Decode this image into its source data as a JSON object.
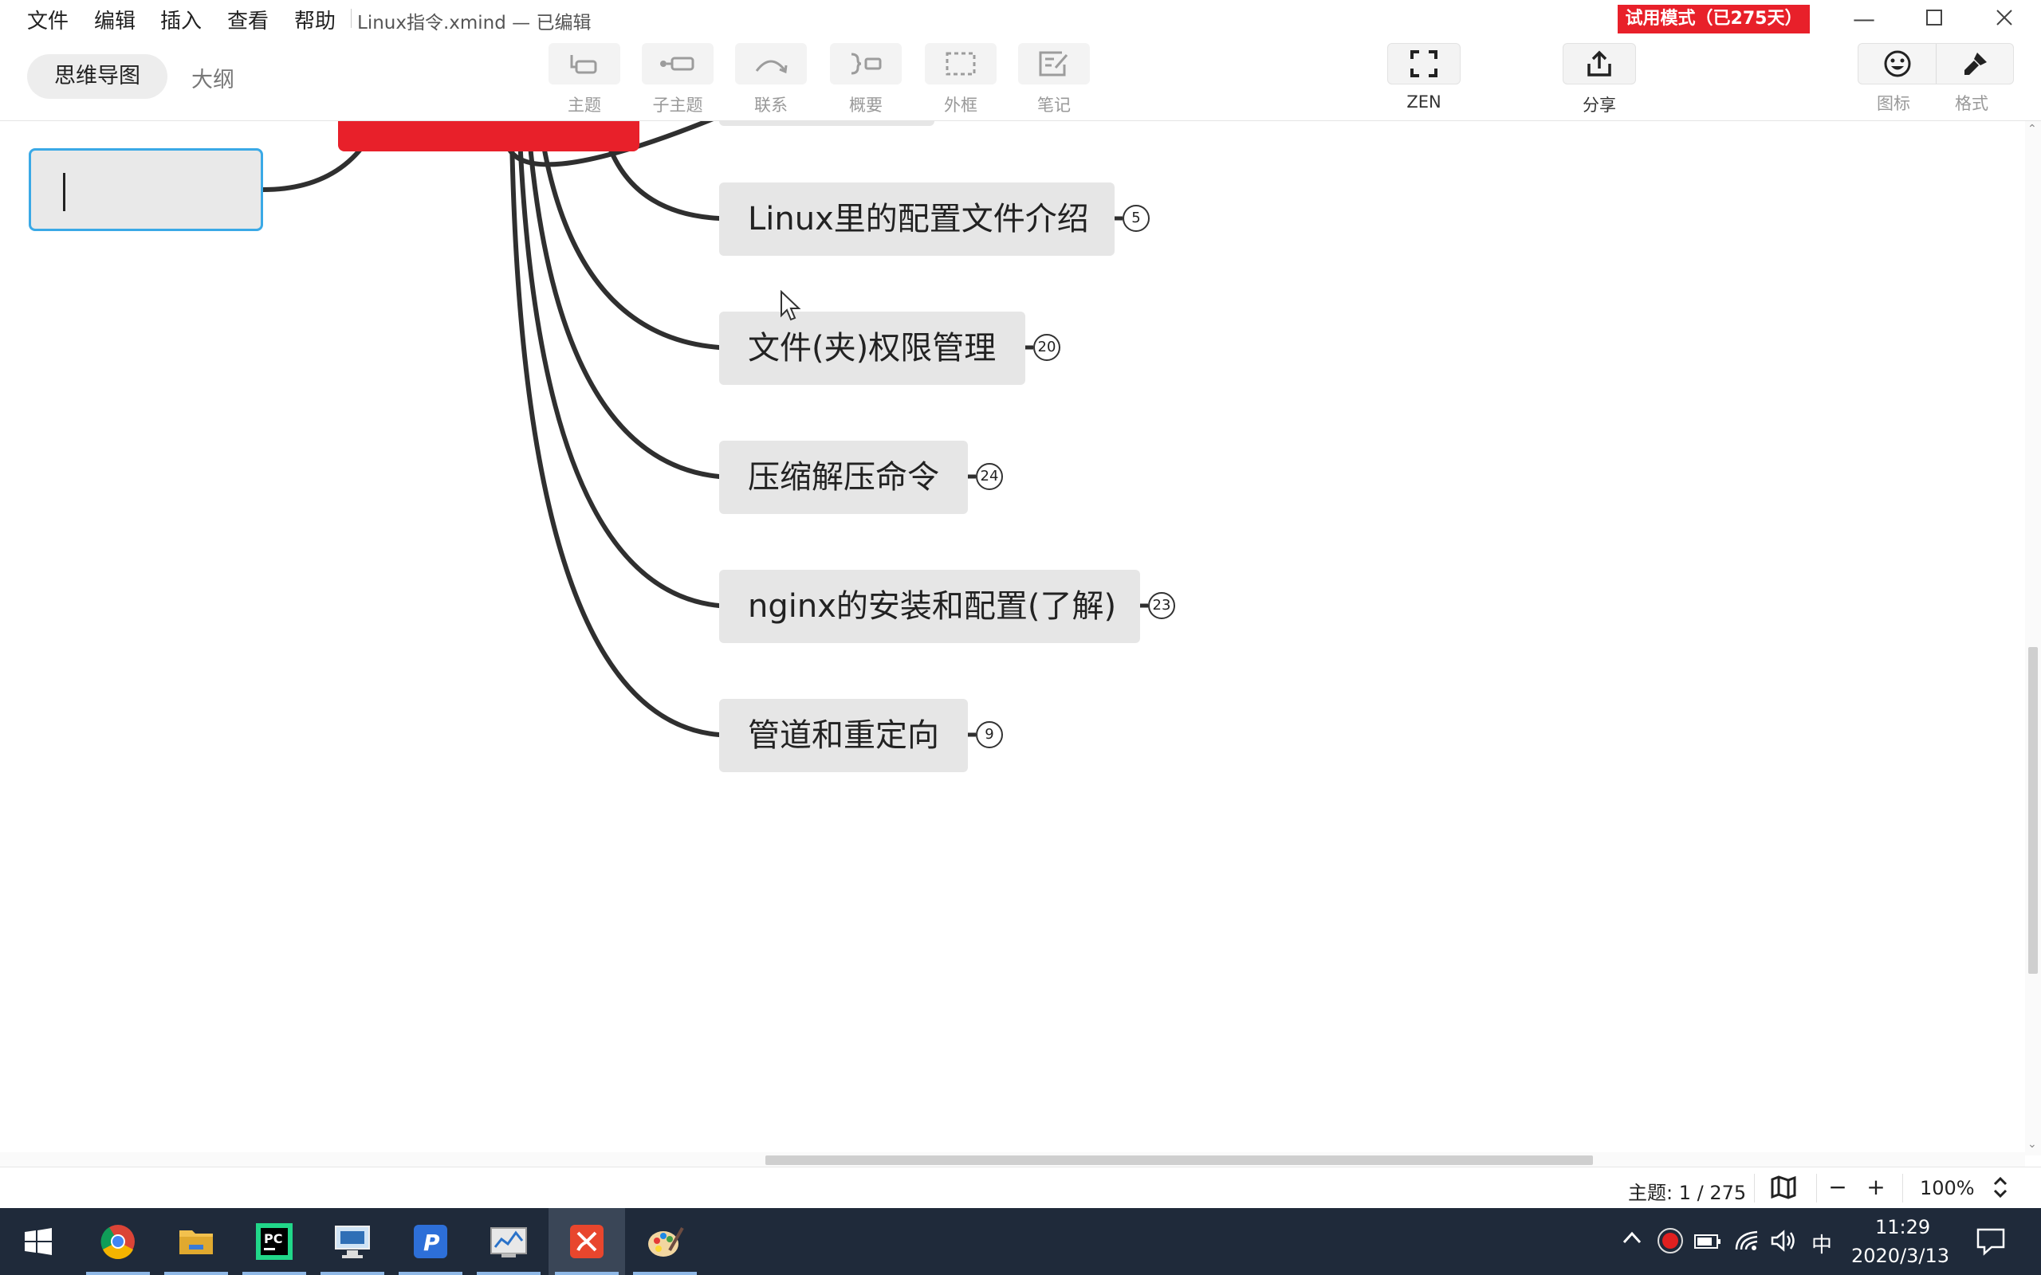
{
  "menu": {
    "items": [
      "文件",
      "编辑",
      "插入",
      "查看",
      "帮助"
    ],
    "doc_title": "Linux指令.xmind — 已编辑",
    "trial_badge": "试用模式（已275天）"
  },
  "toolbar": {
    "mindmap_tab": "思维导图",
    "outline_tab": "大纲",
    "tools": {
      "topic": "主题",
      "subtopic": "子主题",
      "relationship": "联系",
      "summary": "概要",
      "boundary": "外框",
      "note": "笔记",
      "zen": "ZEN",
      "share": "分享",
      "icon": "图标",
      "format": "格式"
    }
  },
  "canvas": {
    "topics": [
      {
        "label": "Linux里的配置文件介绍",
        "count": "5"
      },
      {
        "label": "文件(夹)权限管理",
        "count": "20"
      },
      {
        "label": "压缩解压命令",
        "count": "24"
      },
      {
        "label": "nginx的安装和配置(了解)",
        "count": "23"
      },
      {
        "label": "管道和重定向",
        "count": "9"
      }
    ],
    "colors": {
      "root": "#e8202a",
      "edit_border": "#3aa9e6",
      "topic_bg": "#e6e6e6"
    }
  },
  "status": {
    "topic_count": "主题: 1 / 275",
    "zoom": "100%"
  },
  "taskbar": {
    "ime": "中",
    "time": "11:29",
    "date": "2020/3/13"
  }
}
